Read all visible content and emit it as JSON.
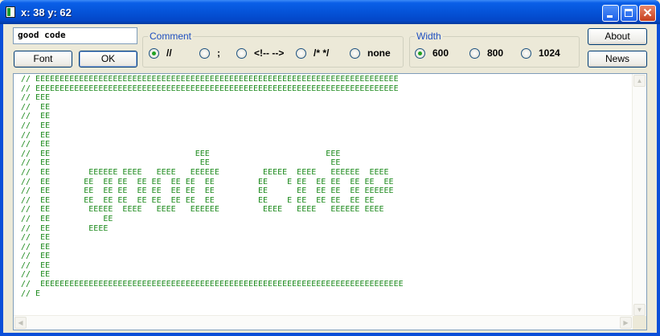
{
  "window": {
    "title": "x: 38 y: 62",
    "minimize_glyph": "",
    "close_glyph": "✕"
  },
  "input": {
    "value": "good code"
  },
  "buttons": {
    "font": "Font",
    "ok": "OK",
    "about": "About",
    "news": "News"
  },
  "comment_group": {
    "label": "Comment",
    "options": [
      "//",
      ";",
      "<!-- -->",
      "/* */",
      "none"
    ],
    "selected": "//"
  },
  "width_group": {
    "label": "Width",
    "options": [
      "600",
      "800",
      "1024"
    ],
    "selected": "600"
  },
  "code_color": "#1d8a1d",
  "code_lines": [
    "// EEEEEEEEEEEEEEEEEEEEEEEEEEEEEEEEEEEEEEEEEEEEEEEEEEEEEEEEEEEEEEEEEEEEEEEEEEE",
    "// EEEEEEEEEEEEEEEEEEEEEEEEEEEEEEEEEEEEEEEEEEEEEEEEEEEEEEEEEEEEEEEEEEEEEEEEEEE",
    "// EEE",
    "//  EE",
    "//  EE",
    "//  EE",
    "//  EE",
    "//  EE",
    "//  EE                              EEE                        EEE",
    "//  EE                               EE                         EE",
    "//  EE        EEEEEE EEEE   EEEE   EEEEEE         EEEEE  EEEE   EEEEEE  EEEE",
    "//  EE       EE  EE EE  EE EE  EE EE  EE         EE    E EE  EE EE  EE EE  EE",
    "//  EE       EE  EE EE  EE EE  EE EE  EE         EE      EE  EE EE  EE EEEEEE",
    "//  EE       EE  EE EE  EE EE  EE EE  EE         EE    E EE  EE EE  EE EE",
    "//  EE        EEEEE  EEEE   EEEE   EEEEEE         EEEE   EEEE   EEEEEE EEEE",
    "//  EE           EE",
    "//  EE        EEEE",
    "//  EE",
    "//  EE",
    "//  EE",
    "//  EE",
    "//  EE",
    "//  EEEEEEEEEEEEEEEEEEEEEEEEEEEEEEEEEEEEEEEEEEEEEEEEEEEEEEEEEEEEEEEEEEEEEEEEEEE",
    "// E"
  ],
  "scroll_glyphs": {
    "up": "▲",
    "down": "▼",
    "left": "◀",
    "right": "▶"
  }
}
